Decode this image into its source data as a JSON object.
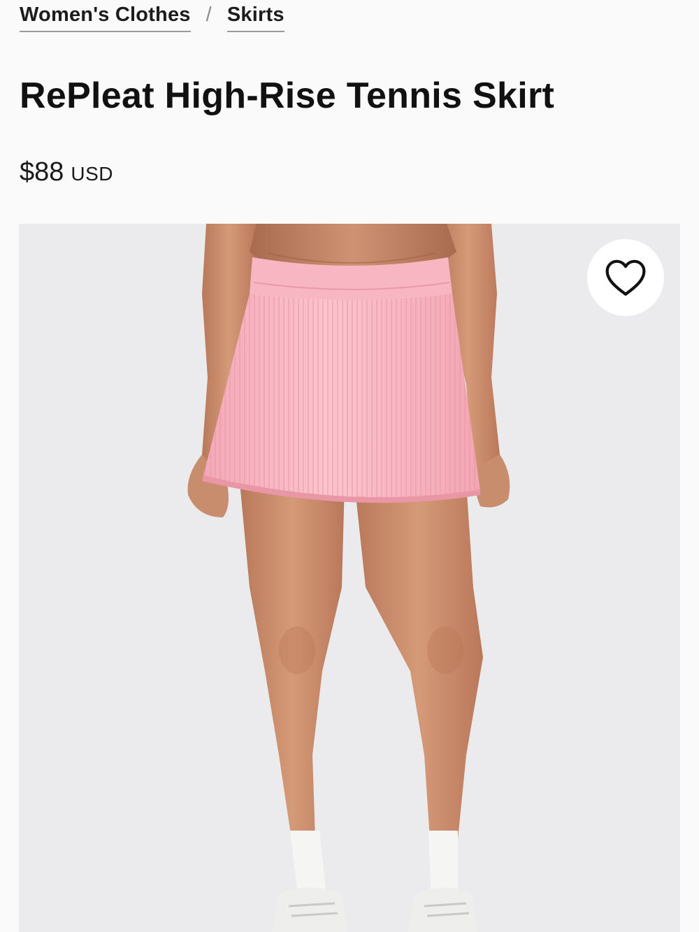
{
  "breadcrumb": {
    "items": [
      {
        "label": "Women's Clothes"
      },
      {
        "label": "Skirts"
      }
    ],
    "separator": "/"
  },
  "product": {
    "title": "RePleat High-Rise Tennis Skirt",
    "price": "$88",
    "currency": "USD"
  },
  "image": {
    "subject": "model wearing pink pleated tennis skirt",
    "skirt_color": "#f7b9c3",
    "background_color": "#e9e9eb"
  },
  "wishlist": {
    "icon": "heart-outline-icon"
  }
}
